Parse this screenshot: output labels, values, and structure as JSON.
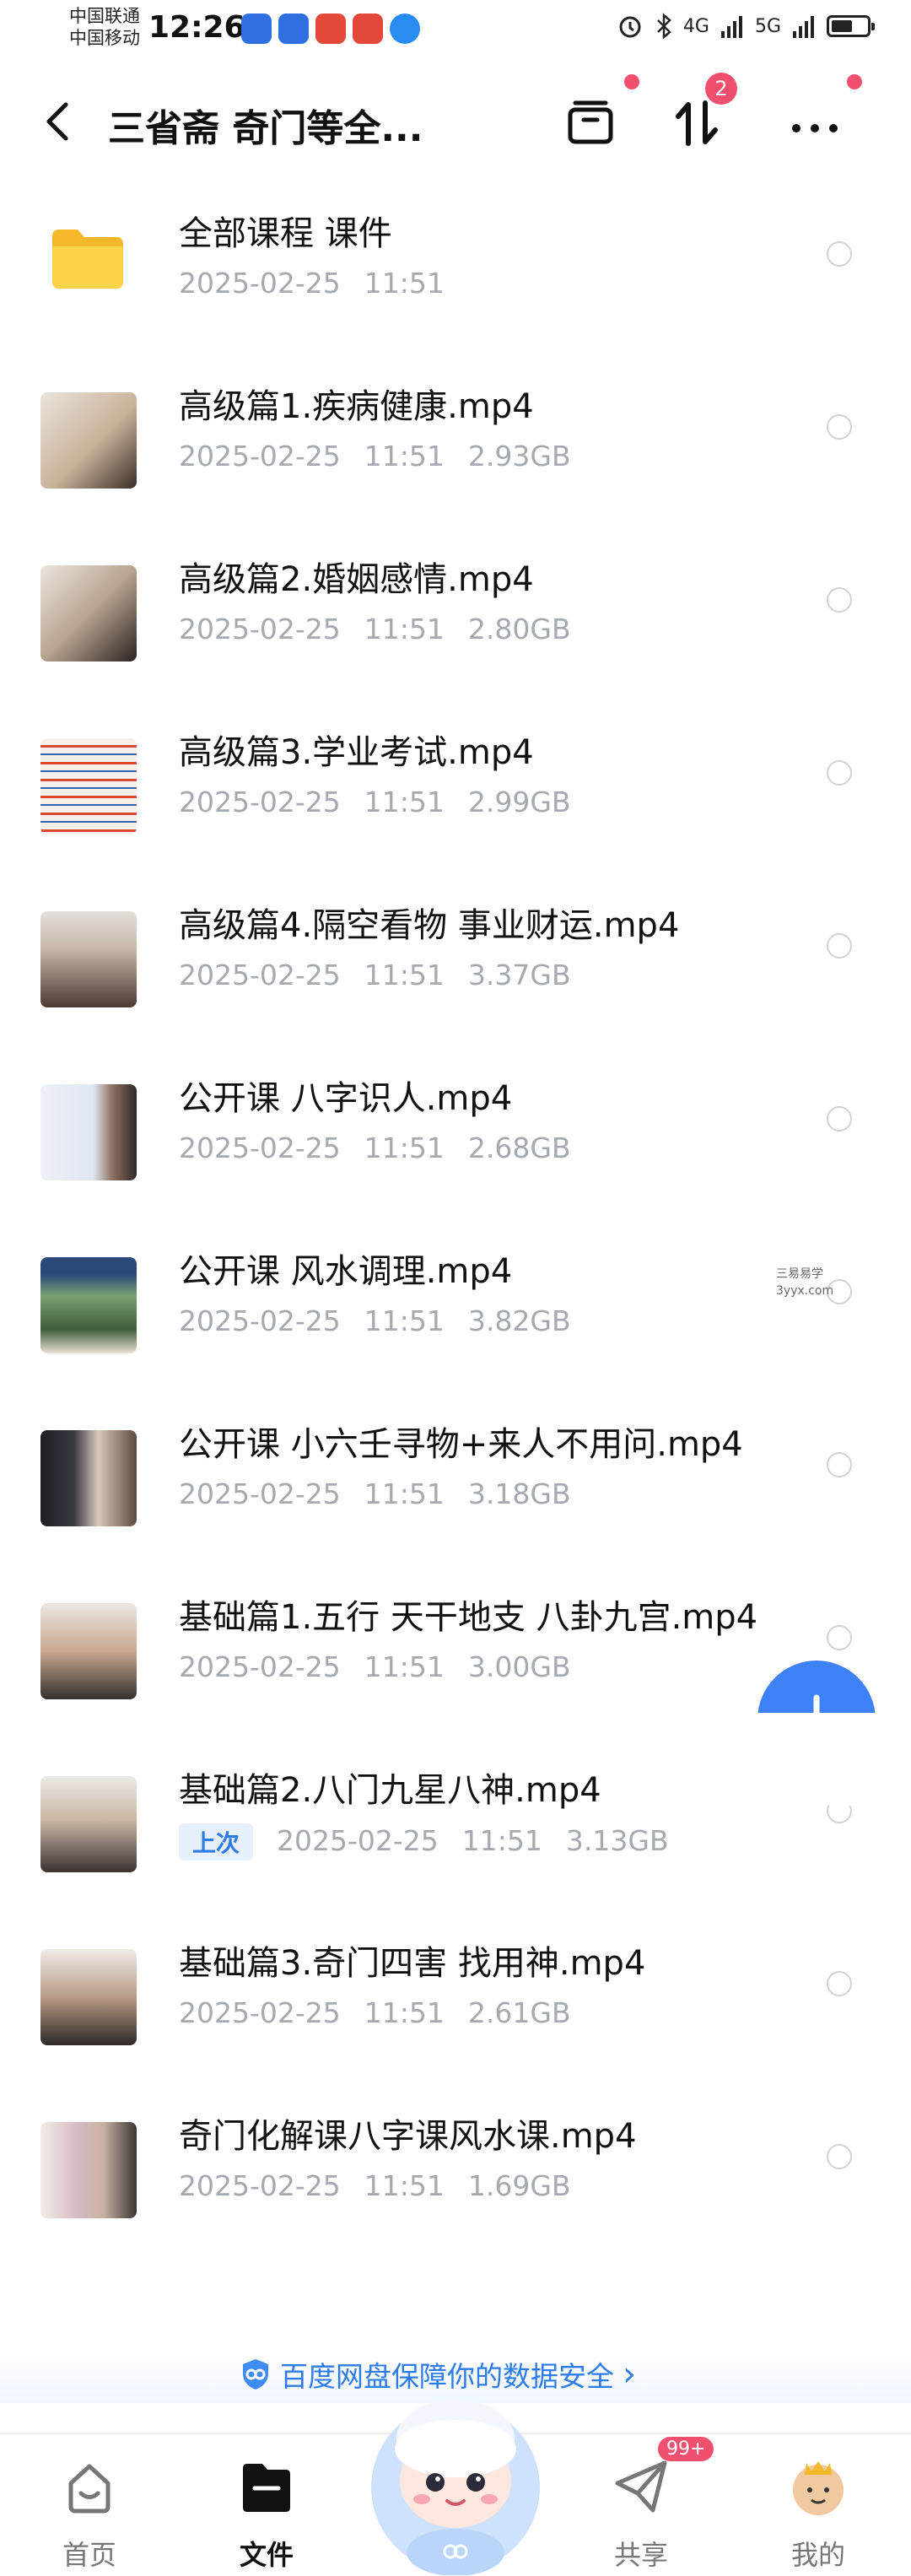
{
  "status_bar": {
    "carrier1": "中国联通",
    "carrier2": "中国移动",
    "time": "12:26",
    "net1": "4G",
    "net2": "5G"
  },
  "header": {
    "title": "三省斋 奇门等全...",
    "transfer_badge": "2"
  },
  "files": [
    {
      "name": "全部课程 课件",
      "date": "2025-02-25",
      "time": "11:51",
      "size": "",
      "type": "folder",
      "recent": ""
    },
    {
      "name": "高级篇1.疾病健康.mp4",
      "date": "2025-02-25",
      "time": "11:51",
      "size": "2.93GB",
      "type": "video",
      "recent": ""
    },
    {
      "name": "高级篇2.婚姻感情.mp4",
      "date": "2025-02-25",
      "time": "11:51",
      "size": "2.80GB",
      "type": "video",
      "recent": ""
    },
    {
      "name": "高级篇3.学业考试.mp4",
      "date": "2025-02-25",
      "time": "11:51",
      "size": "2.99GB",
      "type": "video",
      "recent": ""
    },
    {
      "name": "高级篇4.隔空看物 事业财运.mp4",
      "date": "2025-02-25",
      "time": "11:51",
      "size": "3.37GB",
      "type": "video",
      "recent": ""
    },
    {
      "name": "公开课 八字识人.mp4",
      "date": "2025-02-25",
      "time": "11:51",
      "size": "2.68GB",
      "type": "video",
      "recent": ""
    },
    {
      "name": "公开课 风水调理.mp4",
      "date": "2025-02-25",
      "time": "11:51",
      "size": "3.82GB",
      "type": "video",
      "recent": ""
    },
    {
      "name": "公开课 小六壬寻物+来人不用问.mp4",
      "date": "2025-02-25",
      "time": "11:51",
      "size": "3.18GB",
      "type": "video",
      "recent": ""
    },
    {
      "name": "基础篇1.五行 天干地支 八卦九宫.mp4",
      "date": "2025-02-25",
      "time": "11:51",
      "size": "3.00GB",
      "type": "video",
      "recent": ""
    },
    {
      "name": "基础篇2.八门九星八神.mp4",
      "date": "2025-02-25",
      "time": "11:51",
      "size": "3.13GB",
      "type": "video",
      "recent": "上次"
    },
    {
      "name": "基础篇3.奇门四害 找用神.mp4",
      "date": "2025-02-25",
      "time": "11:51",
      "size": "2.61GB",
      "type": "video",
      "recent": ""
    },
    {
      "name": "奇门化解课八字课风水课.mp4",
      "date": "2025-02-25",
      "time": "11:51",
      "size": "1.69GB",
      "type": "video",
      "recent": ""
    }
  ],
  "watermark": {
    "line1": "三易易学",
    "line2": "3yyx.com"
  },
  "safety_banner": {
    "text": "百度网盘保障你的数据安全",
    "arrow": "›"
  },
  "bottom_nav": {
    "home": "首页",
    "files": "文件",
    "share": "共享",
    "share_badge": "99+",
    "mine": "我的"
  },
  "colors": {
    "accent": "#2e7ce8",
    "badge": "#f0506e",
    "folder": "#f7c234"
  }
}
